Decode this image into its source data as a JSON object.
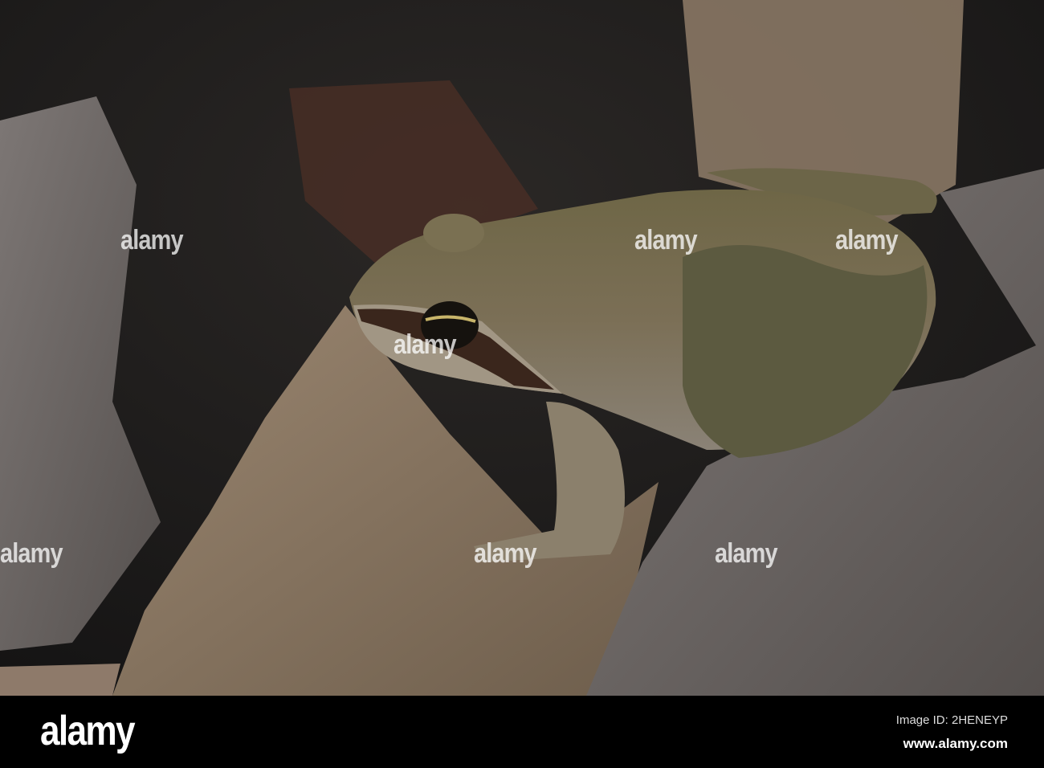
{
  "photo": {
    "subject": "wood frog on dry leaves",
    "watermark": "alamy"
  },
  "footer": {
    "logo": "alamy",
    "image_id": "Image ID: 2HENEYP",
    "website": "www.alamy.com"
  },
  "colors": {
    "background": "#2a2826",
    "leaf_tan": "#8a7864",
    "leaf_gray": "#6e6866",
    "frog_body": "#6b6244",
    "footer": "#000000"
  }
}
